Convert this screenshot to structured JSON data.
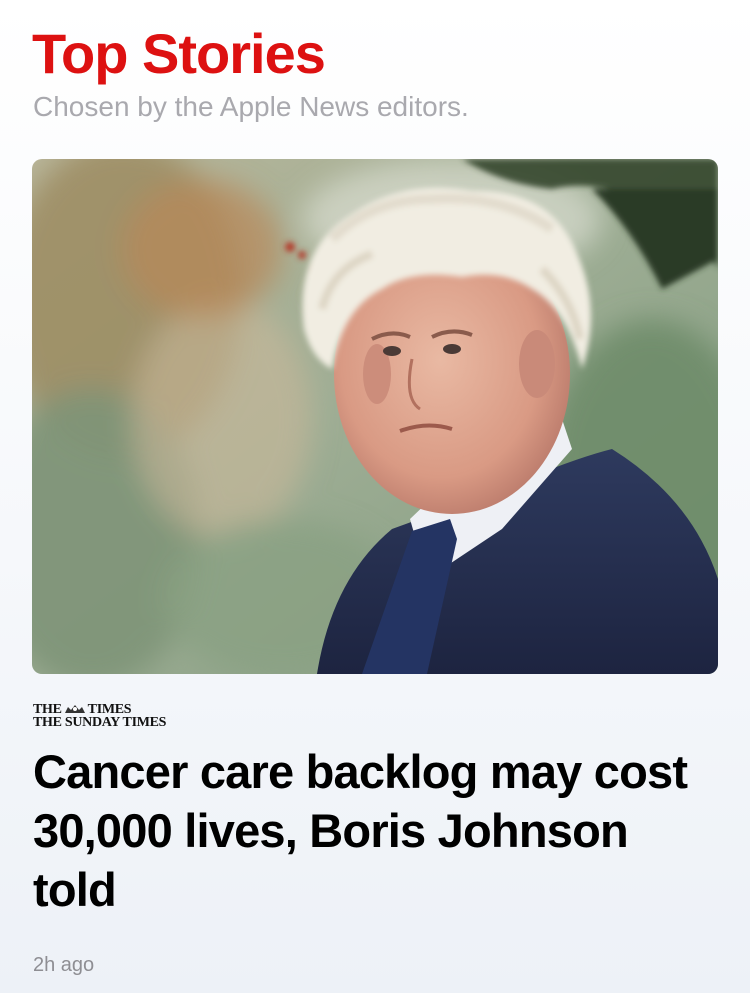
{
  "section": {
    "title": "Top Stories",
    "subtitle": "Chosen by the Apple News editors.",
    "title_color": "#dd1111",
    "subtitle_color": "#a9a9ae"
  },
  "article": {
    "publisher": {
      "line1_left": "THE",
      "line1_right": "TIMES",
      "line2": "THE SUNDAY TIMES",
      "crest_icon": "royal-crest-icon"
    },
    "headline": "Cancer care backlog may cost 30,000 lives, Boris Johnson told",
    "timestamp": "2h ago",
    "timestamp_color": "#8e8e93",
    "image_icon": "news-photo"
  }
}
